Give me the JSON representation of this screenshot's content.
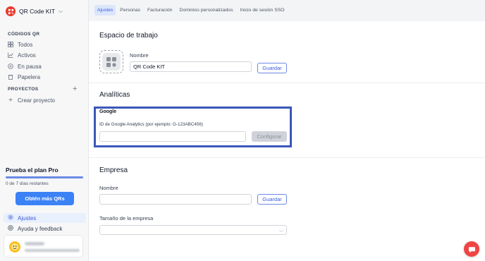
{
  "brand": {
    "name": "QR Code KIT",
    "chevron": "⌵",
    "logo_icon": "qr-logo-icon",
    "accent": "#e63b2e"
  },
  "sidebar": {
    "qr_section": "CÓDIGOS QR",
    "qr_items": [
      {
        "label": "Todos",
        "icon": "grid-icon"
      },
      {
        "label": "Activos",
        "icon": "chart-icon"
      },
      {
        "label": "En pausa",
        "icon": "pause-icon"
      },
      {
        "label": "Papelera",
        "icon": "trash-icon"
      }
    ],
    "projects_section": "PROYECTOS",
    "add_project_symbol": "+",
    "create_project": {
      "label": "Crear proyecto",
      "symbol": "+"
    }
  },
  "plan": {
    "title": "Prueba el plan Pro",
    "days_left": "0 de 7 días restantes",
    "progress_fraction": 1.0,
    "cta": "Obtén más QRs"
  },
  "bottom_nav": [
    {
      "label": "Ajustes",
      "icon": "gear-icon",
      "active": true
    },
    {
      "label": "Ayuda y feedback",
      "icon": "help-icon",
      "active": false
    }
  ],
  "tabs": [
    {
      "label": "Ajustes",
      "active": true
    },
    {
      "label": "Personas",
      "active": false
    },
    {
      "label": "Facturación",
      "active": false
    },
    {
      "label": "Dominios personalizados",
      "active": false
    },
    {
      "label": "Inicio de sesión SSO",
      "active": false
    }
  ],
  "workspace": {
    "heading": "Espacio de trabajo",
    "name_label": "Nombre",
    "name_value": "QR Code KIT",
    "save": "Guardar"
  },
  "analytics": {
    "heading": "Analíticas",
    "provider": "Google",
    "id_label": "ID de Google Analytics (por ejemplo: G-123ABC456)",
    "id_value": "",
    "configure": "Configurar",
    "highlight_color": "#3a58b8"
  },
  "company": {
    "heading": "Empresa",
    "name_label": "Nombre",
    "name_value": "",
    "save": "Guardar",
    "size_label": "Tamaño de la empresa",
    "size_value": ""
  },
  "colors": {
    "primary": "#3b82f6",
    "active_tab_bg": "#dbe6fb",
    "chat": "#ef4444"
  }
}
